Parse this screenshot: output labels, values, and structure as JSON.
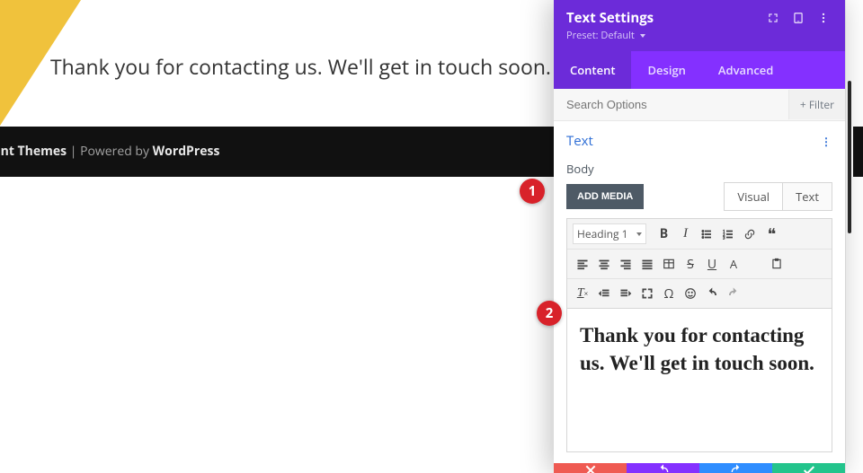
{
  "page": {
    "headline": "Thank you for contacting us. We'll get in touch soon.",
    "footer_left": "egant Themes",
    "footer_mid": " | Powered by ",
    "footer_right": "WordPress"
  },
  "panel": {
    "title": "Text Settings",
    "preset": "Preset: Default",
    "tabs": {
      "content": "Content",
      "design": "Design",
      "advanced": "Advanced"
    },
    "search_placeholder": "Search Options",
    "filter_label": "+ Filter",
    "section_title": "Text",
    "body_label": "Body",
    "add_media": "ADD MEDIA",
    "editor_tabs": {
      "visual": "Visual",
      "text": "Text"
    },
    "format_select": "Heading 1",
    "editor_content": "Thank you for contacting us. We'll get in touch soon.",
    "colors": {
      "primary_purple": "#6c2bd9",
      "tab_purple": "#8430ff",
      "link_blue": "#2e6ed6",
      "close_red": "#ef5a52",
      "redo_blue": "#2f8dff",
      "ok_green": "#23c48c",
      "accent_yellow": "#f0c23c",
      "badge_red": "#d8222a"
    }
  },
  "annotations": {
    "one": "1",
    "two": "2"
  },
  "chart_data": null
}
